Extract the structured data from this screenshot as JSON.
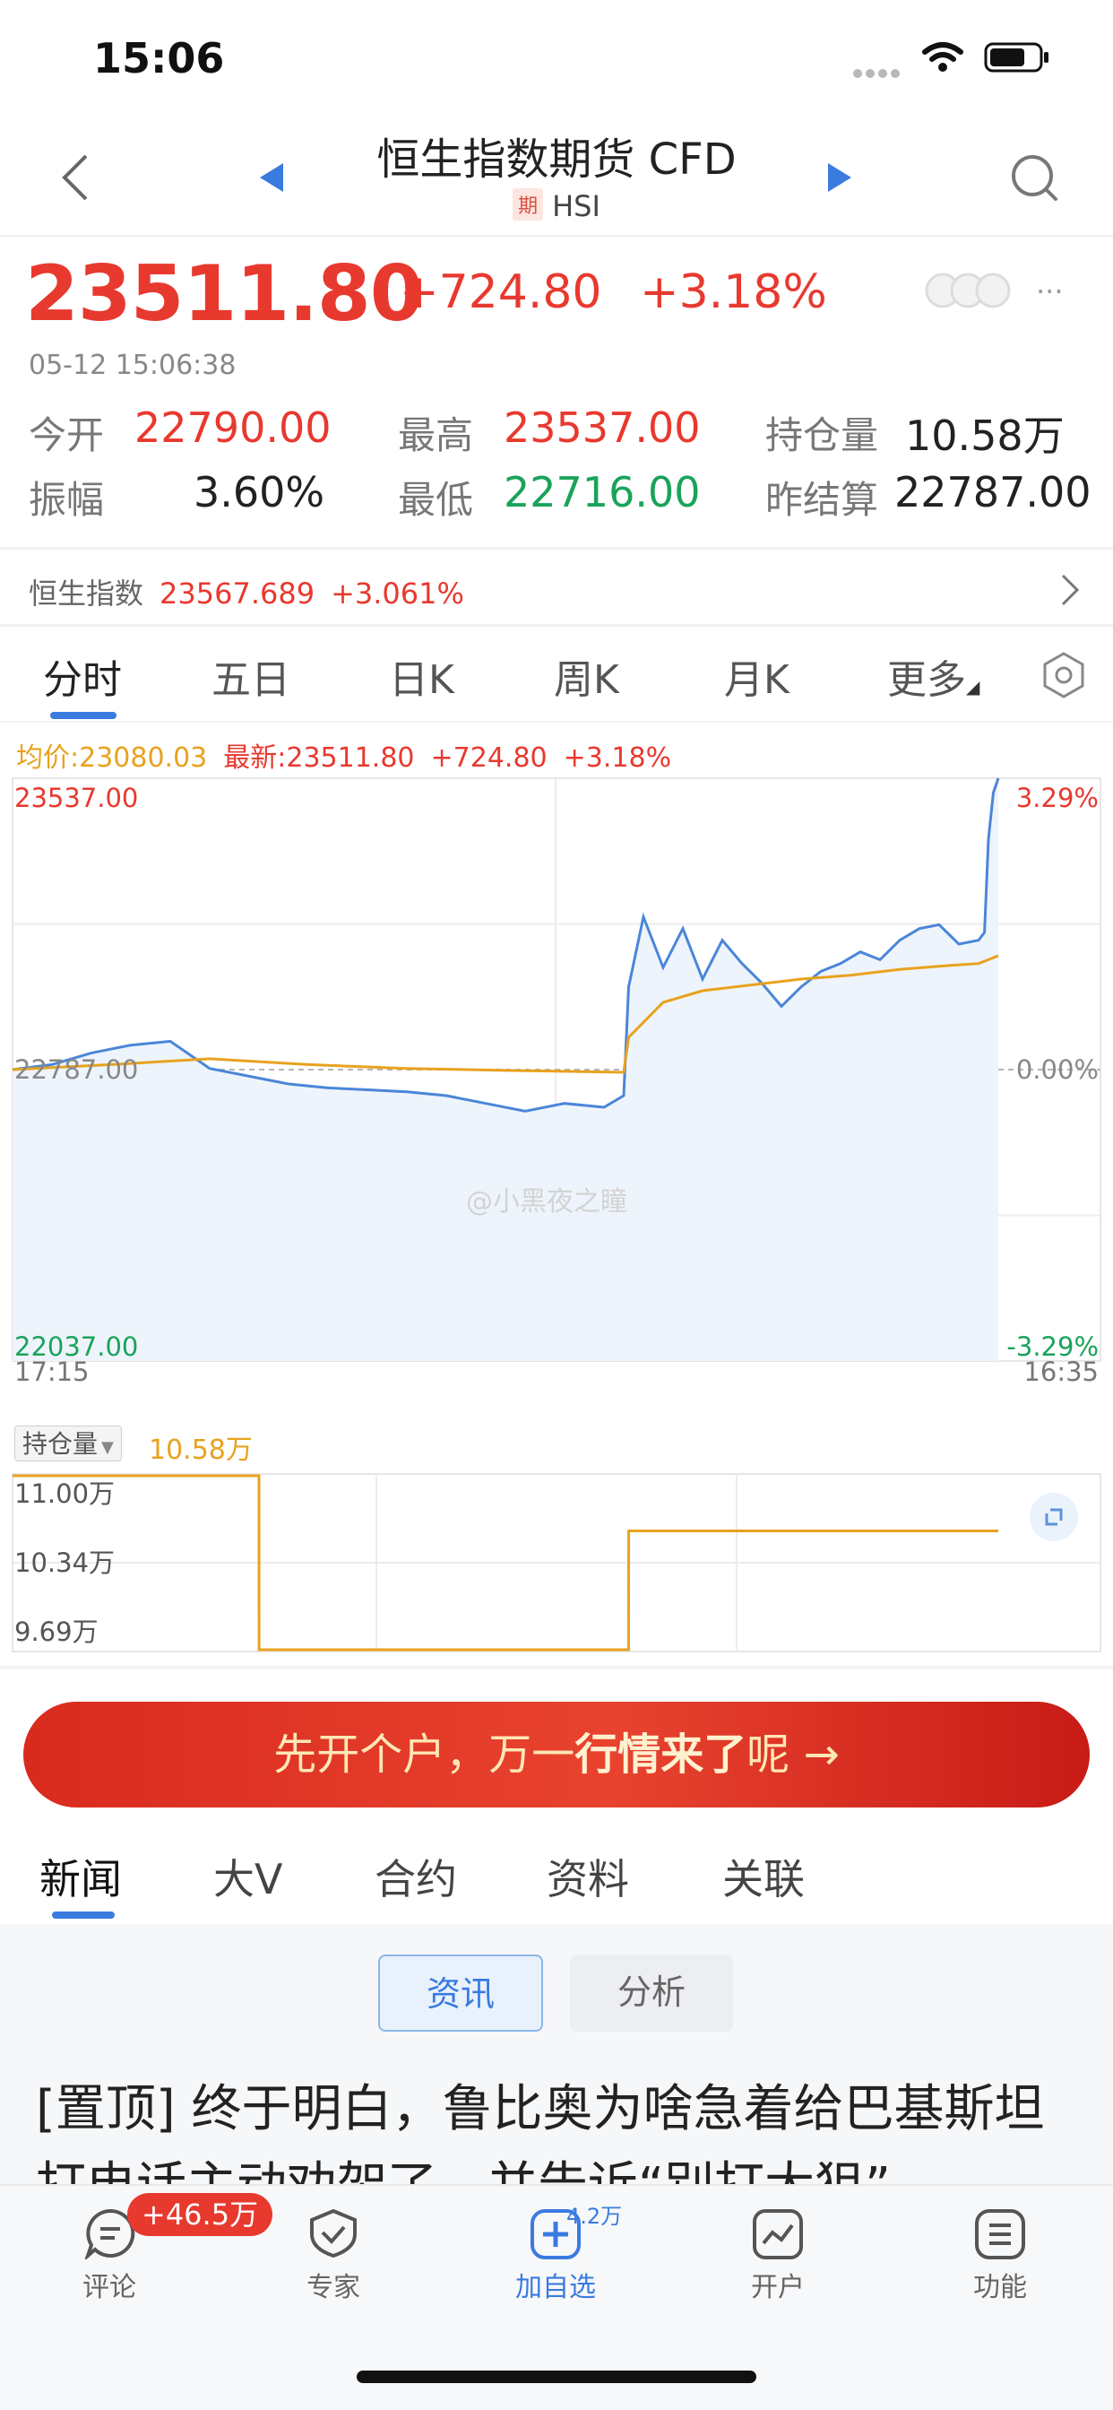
{
  "status_bar": {
    "time": "15:06"
  },
  "header": {
    "title": "恒生指数期货 CFD",
    "badge": "期",
    "symbol": "HSI"
  },
  "quote": {
    "price": "23511.80",
    "change": "+724.80",
    "change_pct": "+3.18%",
    "timestamp": "05-12 15:06:38",
    "open_label": "今开",
    "open": "22790.00",
    "high_label": "最高",
    "high": "23537.00",
    "oi_label": "持仓量",
    "oi": "10.58万",
    "amp_label": "振幅",
    "amp": "3.60%",
    "low_label": "最低",
    "low": "22716.00",
    "prev_label": "昨结算",
    "prev": "22787.00"
  },
  "index_line": {
    "name": "恒生指数",
    "value": "23567.689",
    "pct": "+3.061%"
  },
  "chart_tabs": [
    "分时",
    "五日",
    "日K",
    "周K",
    "月K",
    "更多"
  ],
  "chart_legend": {
    "avg": "均价:23080.03",
    "latest": "最新:23511.80",
    "chg": "+724.80",
    "pct": "+3.18%"
  },
  "chart_data": [
    {
      "type": "line",
      "y_max_label": "23537.00",
      "y_mid_label": "22787.00",
      "y_min_label": "22037.00",
      "pct_max_label": "3.29%",
      "pct_mid_label": "0.00%",
      "pct_min_label": "-3.29%",
      "x_start_label": "17:15",
      "x_end_label": "16:35",
      "ylim": [
        22037,
        23537
      ],
      "watermark": "@小黑夜之瞳",
      "series": [
        {
          "role": "price",
          "color": "#4a86d8",
          "x": [
            0,
            4,
            8,
            12,
            16,
            20,
            24,
            28,
            32,
            36,
            40,
            44,
            48,
            52,
            56,
            60,
            62,
            62.5,
            64,
            66,
            68,
            70,
            72,
            74,
            76,
            78,
            80,
            82,
            84,
            86,
            88,
            90,
            92,
            94,
            96,
            98,
            98.6,
            99,
            99.5,
            100
          ],
          "values": [
            22787,
            22800,
            22830,
            22850,
            22860,
            22790,
            22770,
            22750,
            22740,
            22735,
            22730,
            22720,
            22700,
            22680,
            22700,
            22690,
            22720,
            23000,
            23180,
            23050,
            23150,
            23020,
            23120,
            23060,
            23010,
            22950,
            23000,
            23040,
            23060,
            23090,
            23070,
            23120,
            23150,
            23160,
            23110,
            23120,
            23140,
            23380,
            23500,
            23537
          ]
        },
        {
          "role": "average",
          "color": "#e8a21e",
          "x": [
            0,
            10,
            20,
            30,
            40,
            50,
            62,
            62.5,
            66,
            70,
            75,
            80,
            85,
            90,
            95,
            98,
            99,
            100
          ],
          "values": [
            22787,
            22800,
            22815,
            22800,
            22790,
            22785,
            22780,
            22870,
            22960,
            22990,
            23005,
            23020,
            23030,
            23045,
            23055,
            23060,
            23070,
            23080
          ]
        }
      ]
    },
    {
      "type": "line",
      "label": "持仓量",
      "value_label": "10.58万",
      "y_labels": [
        "11.00万",
        "10.34万",
        "9.69万"
      ],
      "ylim": [
        9.69,
        11.0
      ],
      "series": [
        {
          "role": "open_interest",
          "color": "#e8a21e",
          "x": [
            0,
            25,
            25.01,
            62.5,
            62.51,
            100
          ],
          "values": [
            11.0,
            11.0,
            9.69,
            9.69,
            10.58,
            10.58
          ]
        }
      ]
    }
  ],
  "banner": {
    "prefix": "先开个户，万一",
    "bold": "行情来了",
    "suffix": "呢 →"
  },
  "news_tabs": [
    "新闻",
    "大V",
    "合约",
    "资料",
    "关联"
  ],
  "news_subtabs": [
    "资讯",
    "分析"
  ],
  "headline": "[置顶] 终于明白，鲁比奥为啥急着给巴基斯坦打电话主动劝架了，并告诉“别打大狙”",
  "bottom_nav": {
    "comment_badge": "+46.5万",
    "add_badge": "4.2万",
    "items": [
      "评论",
      "专家",
      "加自选",
      "开户",
      "功能"
    ]
  }
}
